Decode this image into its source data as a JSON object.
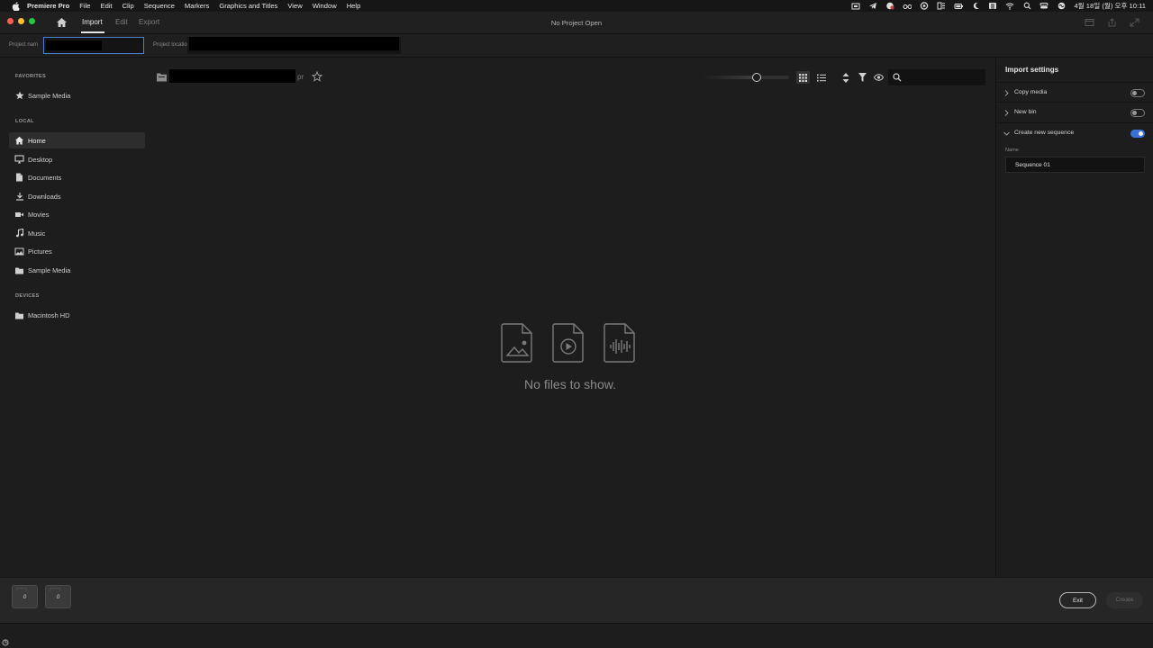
{
  "menubar": {
    "app_name": "Premiere Pro",
    "items": [
      "File",
      "Edit",
      "Clip",
      "Sequence",
      "Markers",
      "Graphics and Titles",
      "View",
      "Window",
      "Help"
    ],
    "clock": "4월 18일 (월) 오후 10:11"
  },
  "header": {
    "tabs": [
      {
        "label": "Import",
        "active": true
      },
      {
        "label": "Edit",
        "active": false
      },
      {
        "label": "Export",
        "active": false
      }
    ],
    "title": "No Project Open"
  },
  "project": {
    "name_label": "Project nam",
    "location_label": "Project location"
  },
  "sidebar": {
    "sections": [
      {
        "title": "FAVORITES",
        "items": [
          {
            "label": "Sample Media",
            "icon": "star-icon"
          }
        ]
      },
      {
        "title": "LOCAL",
        "items": [
          {
            "label": "Home",
            "icon": "home-icon",
            "active": true
          },
          {
            "label": "Desktop",
            "icon": "desktop-icon"
          },
          {
            "label": "Documents",
            "icon": "document-icon"
          },
          {
            "label": "Downloads",
            "icon": "download-icon"
          },
          {
            "label": "Movies",
            "icon": "movie-icon"
          },
          {
            "label": "Music",
            "icon": "music-icon"
          },
          {
            "label": "Pictures",
            "icon": "picture-icon"
          },
          {
            "label": "Sample Media",
            "icon": "folder-icon"
          }
        ]
      },
      {
        "title": "DEVICES",
        "items": [
          {
            "label": "Macintosh HD",
            "icon": "folder-icon"
          }
        ]
      }
    ]
  },
  "browser": {
    "path_suffix": "pr",
    "thumbnail_zoom": 0.62,
    "search_value": "",
    "empty_message": "No files to show."
  },
  "import_settings": {
    "title": "Import settings",
    "options": [
      {
        "label": "Copy media",
        "enabled": false,
        "expanded": false
      },
      {
        "label": "New bin",
        "enabled": false,
        "expanded": false
      },
      {
        "label": "Create new sequence",
        "enabled": true,
        "expanded": true
      }
    ],
    "name_label": "Name",
    "sequence_name": "Sequence 01"
  },
  "bottom": {
    "tray_counts": [
      "0",
      "0"
    ],
    "exit_label": "Exit",
    "create_label": "Create"
  },
  "colors": {
    "accent": "#3a72d6",
    "panel_bg": "#1d1d1d",
    "bottom_bg": "#262626"
  }
}
